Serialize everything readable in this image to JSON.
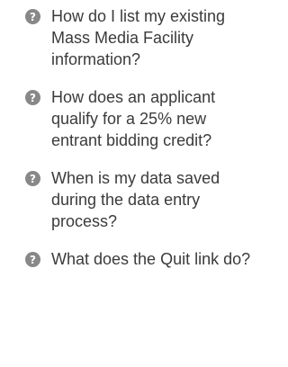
{
  "faq": {
    "icon": "question-circle-icon",
    "icon_color": "#888888",
    "items": [
      {
        "question": "How do I list my existing Mass Media Facility information?"
      },
      {
        "question": "How does an applicant qualify for a 25% new entrant bidding credit?"
      },
      {
        "question": "When is my data saved during the data entry process?"
      },
      {
        "question": "What does the Quit link do?"
      }
    ]
  }
}
